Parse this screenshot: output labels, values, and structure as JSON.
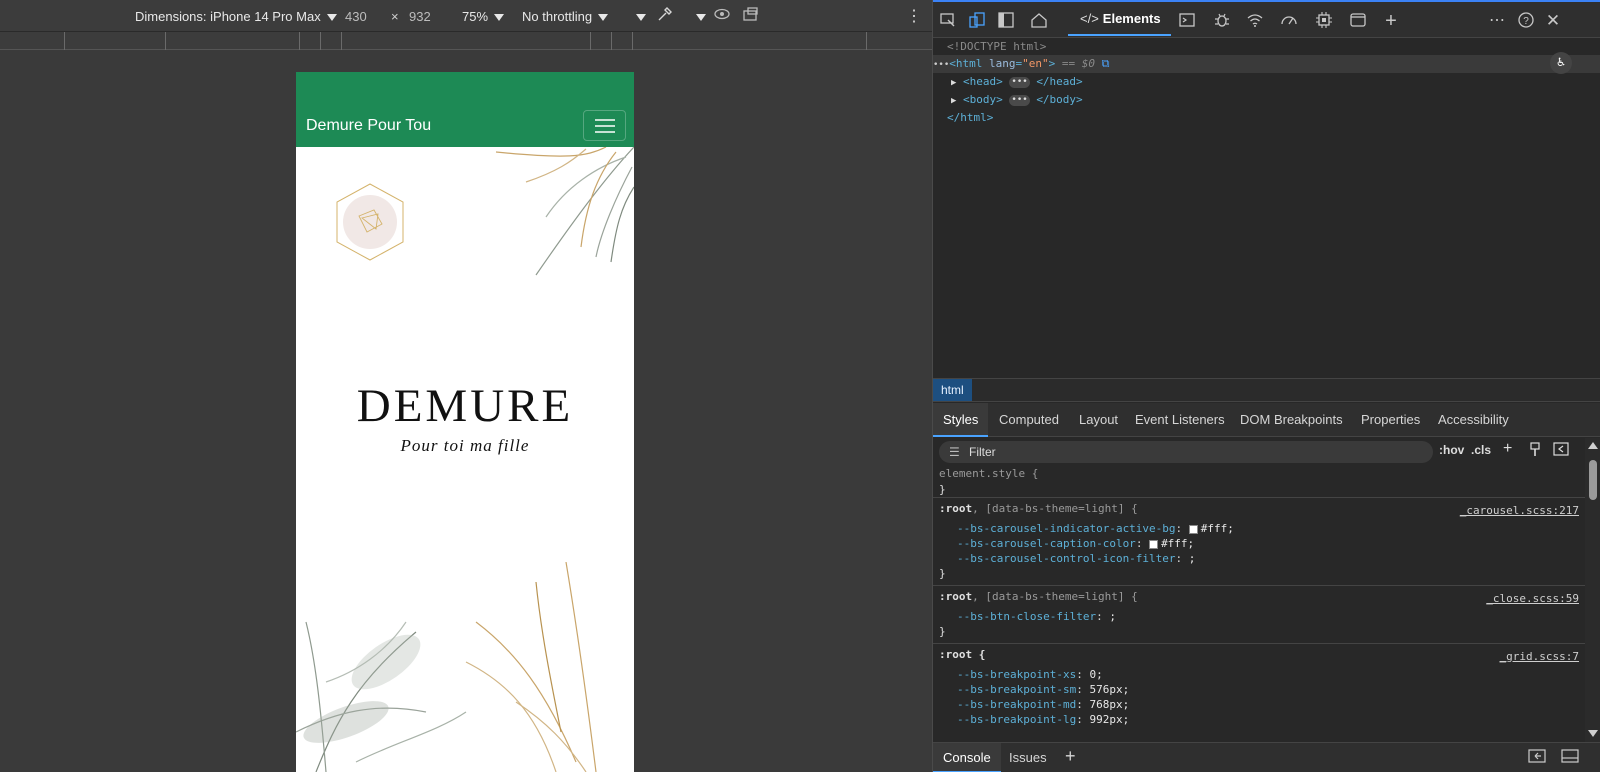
{
  "device_toolbar": {
    "dimensions_label": "Dimensions: iPhone 14 Pro Max",
    "width_value": "430",
    "times": "×",
    "height_value": "932",
    "zoom": "75%",
    "throttling": "No throttling"
  },
  "device_page": {
    "brand": "Demure Pour Tou",
    "hero_title": "DEMURE",
    "hero_subtitle": "Pour toi ma fille"
  },
  "devtools": {
    "active_tab": "Elements",
    "dom": {
      "doctype": "<!DOCTYPE html>",
      "html_open_tag": "html",
      "html_attr_name": "lang",
      "html_attr_value": "\"en\"",
      "selected_marker": "== $0",
      "head_open": "<head>",
      "head_close": "</head>",
      "body_open": "<body>",
      "body_close": "</body>",
      "html_close": "</html>",
      "ellipsis": "•••"
    },
    "breadcrumb": "html",
    "subtabs": [
      "Styles",
      "Computed",
      "Layout",
      "Event Listeners",
      "DOM Breakpoints",
      "Properties",
      "Accessibility"
    ],
    "filter_placeholder": "Filter",
    "hov": ":hov",
    "cls": ".cls",
    "styles": {
      "element_style_selector": "element.style {",
      "element_style_close": "}",
      "rule1_selector": ":root",
      "rule1_selector_extra": ", [data-bs-theme=light] {",
      "rule1_source": "_carousel.scss:217",
      "rule1_props": [
        {
          "name": "--bs-carousel-indicator-active-bg",
          "value": "#fff;"
        },
        {
          "name": "--bs-carousel-caption-color",
          "value": "#fff;"
        },
        {
          "name": "--bs-carousel-control-icon-filter",
          "value": ";"
        }
      ],
      "rule2_selector": ":root",
      "rule2_selector_extra": ", [data-bs-theme=light] {",
      "rule2_source": "_close.scss:59",
      "rule2_props": [
        {
          "name": "--bs-btn-close-filter",
          "value": ";"
        }
      ],
      "rule3_selector": ":root {",
      "rule3_source": "_grid.scss:7",
      "rule3_props": [
        {
          "name": "--bs-breakpoint-xs",
          "value": "0;"
        },
        {
          "name": "--bs-breakpoint-sm",
          "value": "576px;"
        },
        {
          "name": "--bs-breakpoint-md",
          "value": "768px;"
        },
        {
          "name": "--bs-breakpoint-lg",
          "value": "992px;"
        }
      ],
      "close_brace": "}"
    },
    "drawer_tabs": [
      "Console",
      "Issues"
    ]
  }
}
